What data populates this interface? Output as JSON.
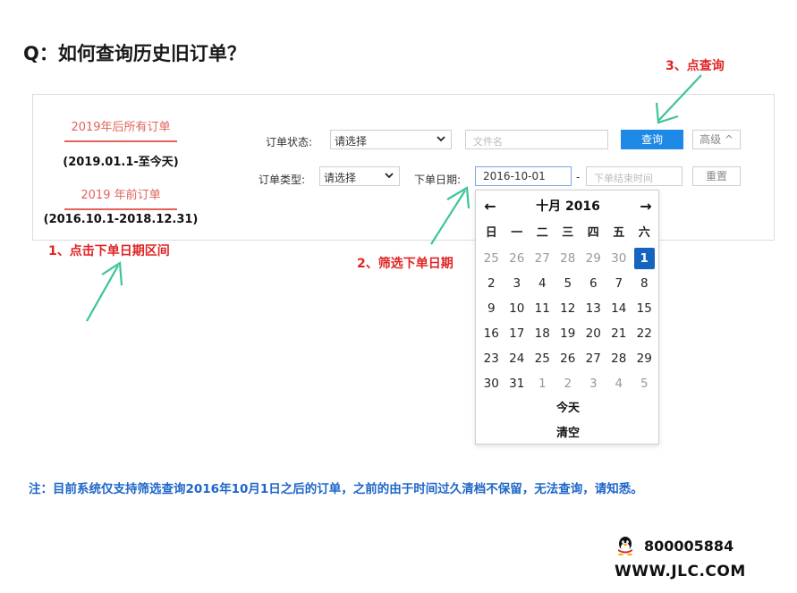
{
  "title": "Q：如何查询历史旧订单？",
  "date_ranges": [
    {
      "label": "2019年后所有订单",
      "range": "(2019.01.1-至今天)"
    },
    {
      "label": "2019 年前订单",
      "range": "(2016.10.1-2018.12.31)"
    }
  ],
  "filters": {
    "status_label": "订单状态:",
    "status_value": "请选择",
    "filename_placeholder": "文件名",
    "type_label": "订单类型:",
    "type_value": "请选择",
    "date_label": "下单日期:",
    "start_date": "2016-10-01",
    "range_dash": "-",
    "end_placeholder": "下单结束时间",
    "query_button": "查询",
    "advanced_button": "高级 ^",
    "reset_button": "重置"
  },
  "annotations": {
    "step1": "1、点击下单日期区间",
    "step2": "2、筛选下单日期",
    "step3": "3、点查询"
  },
  "calendar": {
    "prev_icon": "←",
    "next_icon": "→",
    "month_title": "十月 2016",
    "weekdays": [
      "日",
      "一",
      "二",
      "三",
      "四",
      "五",
      "六"
    ],
    "days": [
      {
        "d": "25",
        "muted": true
      },
      {
        "d": "26",
        "muted": true
      },
      {
        "d": "27",
        "muted": true
      },
      {
        "d": "28",
        "muted": true
      },
      {
        "d": "29",
        "muted": true
      },
      {
        "d": "30",
        "muted": true
      },
      {
        "d": "1",
        "selected": true
      },
      {
        "d": "2"
      },
      {
        "d": "3"
      },
      {
        "d": "4"
      },
      {
        "d": "5"
      },
      {
        "d": "6"
      },
      {
        "d": "7"
      },
      {
        "d": "8"
      },
      {
        "d": "9"
      },
      {
        "d": "10"
      },
      {
        "d": "11"
      },
      {
        "d": "12"
      },
      {
        "d": "13"
      },
      {
        "d": "14"
      },
      {
        "d": "15"
      },
      {
        "d": "16"
      },
      {
        "d": "17"
      },
      {
        "d": "18"
      },
      {
        "d": "19"
      },
      {
        "d": "20"
      },
      {
        "d": "21"
      },
      {
        "d": "22"
      },
      {
        "d": "23"
      },
      {
        "d": "24"
      },
      {
        "d": "25"
      },
      {
        "d": "26"
      },
      {
        "d": "27"
      },
      {
        "d": "28"
      },
      {
        "d": "29"
      },
      {
        "d": "30"
      },
      {
        "d": "31"
      },
      {
        "d": "1",
        "muted": true
      },
      {
        "d": "2",
        "muted": true
      },
      {
        "d": "3",
        "muted": true
      },
      {
        "d": "4",
        "muted": true
      },
      {
        "d": "5",
        "muted": true
      }
    ],
    "today_label": "今天",
    "clear_label": "清空"
  },
  "note": "注：目前系统仅支持筛选查询2016年10月1日之后的订单，之前的由于时间过久清档不保留，无法查询，请知悉。",
  "contact": {
    "qq_icon": "qq-penguin-icon",
    "qq_number": "800005884",
    "website": "WWW.JLC.COM"
  },
  "colors": {
    "accent_blue": "#1e88e5",
    "selected_day": "#1565c0",
    "annotation_red": "#e02424",
    "link_red": "#e0645a",
    "arrow_green": "#3cc49a",
    "note_blue": "#1e66c8"
  }
}
